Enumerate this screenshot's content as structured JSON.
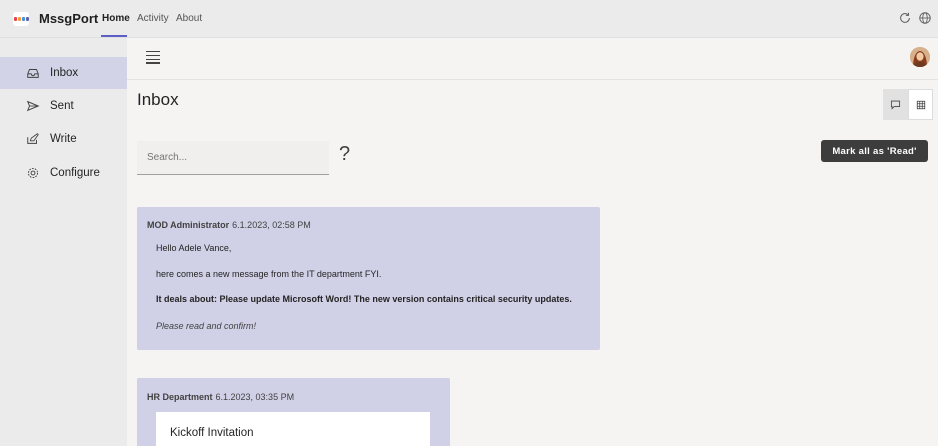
{
  "app": {
    "name": "MssgPort",
    "logo_colors": [
      "#e8434b",
      "#f59d38",
      "#4a90e2",
      "#6264a7"
    ]
  },
  "nav": {
    "tabs": [
      {
        "label": "Home",
        "active": true
      },
      {
        "label": "Activity",
        "active": false
      },
      {
        "label": "About",
        "active": false
      }
    ]
  },
  "top_icons": [
    "refresh-icon",
    "globe-icon"
  ],
  "sidebar": {
    "items": [
      {
        "label": "Inbox",
        "icon": "inbox-icon",
        "active": true
      },
      {
        "label": "Sent",
        "icon": "send-icon",
        "active": false
      },
      {
        "label": "Write",
        "icon": "compose-icon",
        "active": false
      },
      {
        "label": "Configure",
        "icon": "gear-icon",
        "active": false
      }
    ]
  },
  "main": {
    "title": "Inbox",
    "search_placeholder": "Search...",
    "help_text": "?",
    "mark_all_read_label": "Mark all as 'Read'",
    "view_modes": [
      "chat-view-icon",
      "grid-view-icon"
    ]
  },
  "messages": [
    {
      "sender": "MOD Administrator",
      "date": "6.1.2023, 02:58 PM",
      "greeting": "Hello Adele Vance,",
      "line1": "here comes a new message from the IT department FYI.",
      "line2": "It deals about: Please update Microsoft Word! The new version contains critical security updates.",
      "line3": "Please read and confirm!"
    },
    {
      "sender": "HR Department",
      "date": "6.1.2023, 03:35 PM",
      "card_title": "Kickoff Invitation"
    }
  ],
  "colors": {
    "accent": "#5b5fc7",
    "card_bg": "#d0d0e6",
    "sidebar_active": "#d2d3e6",
    "button_dark": "#3d3d3d"
  }
}
